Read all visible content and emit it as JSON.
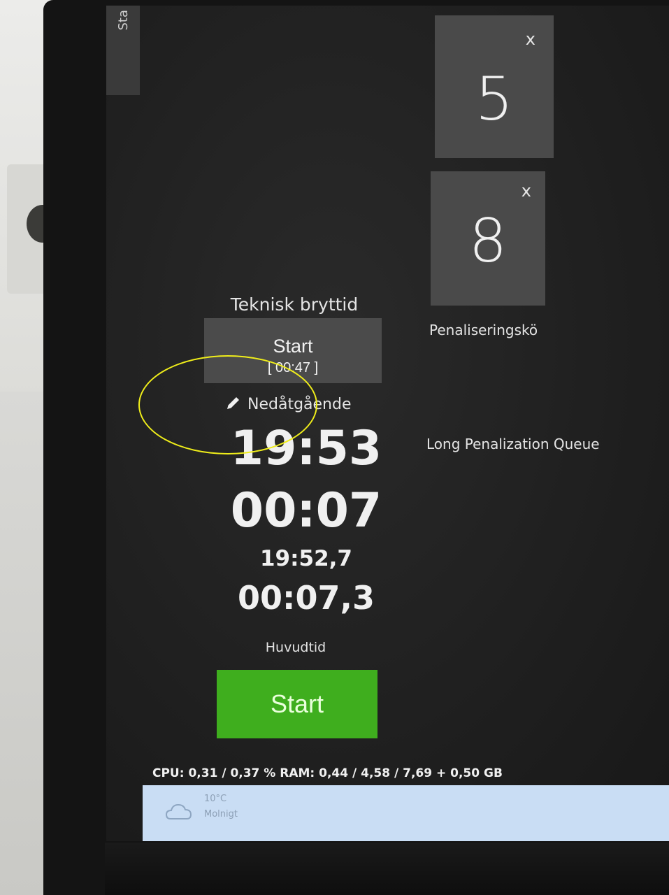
{
  "side_tab": {
    "label": "Sta"
  },
  "penalty_tiles": [
    {
      "number": "5",
      "close": "x"
    },
    {
      "number": "8",
      "close": "x"
    }
  ],
  "penalty_queue_label": "Penaliseringskö",
  "long_penalty_queue_label": "Long Penalization Queue",
  "technical_break": {
    "title": "Teknisk bryttid",
    "button_label": "Start",
    "button_time": "[ 00:47 ]"
  },
  "mode": {
    "icon": "pencil-icon",
    "label": "Nedåtgående"
  },
  "clock": {
    "main": "19:53",
    "elapsed": "00:07",
    "main_precise": "19:52,7",
    "elapsed_precise": "00:07,3",
    "label": "Huvudtid"
  },
  "main_start_button": "Start",
  "status_bar": "CPU: 0,31 / 0,37 % RAM: 0,44 / 4,58 / 7,69 + 0,50 GB",
  "taskbar": {
    "weather": {
      "icon": "cloud-icon",
      "temp": "10°C",
      "desc": "Molnigt"
    }
  },
  "colors": {
    "start_green": "#3fae1e",
    "tile_gray": "#4a4a4a",
    "annotation_yellow": "#f0ee1a",
    "taskbar_blue": "#c9ddf4"
  }
}
